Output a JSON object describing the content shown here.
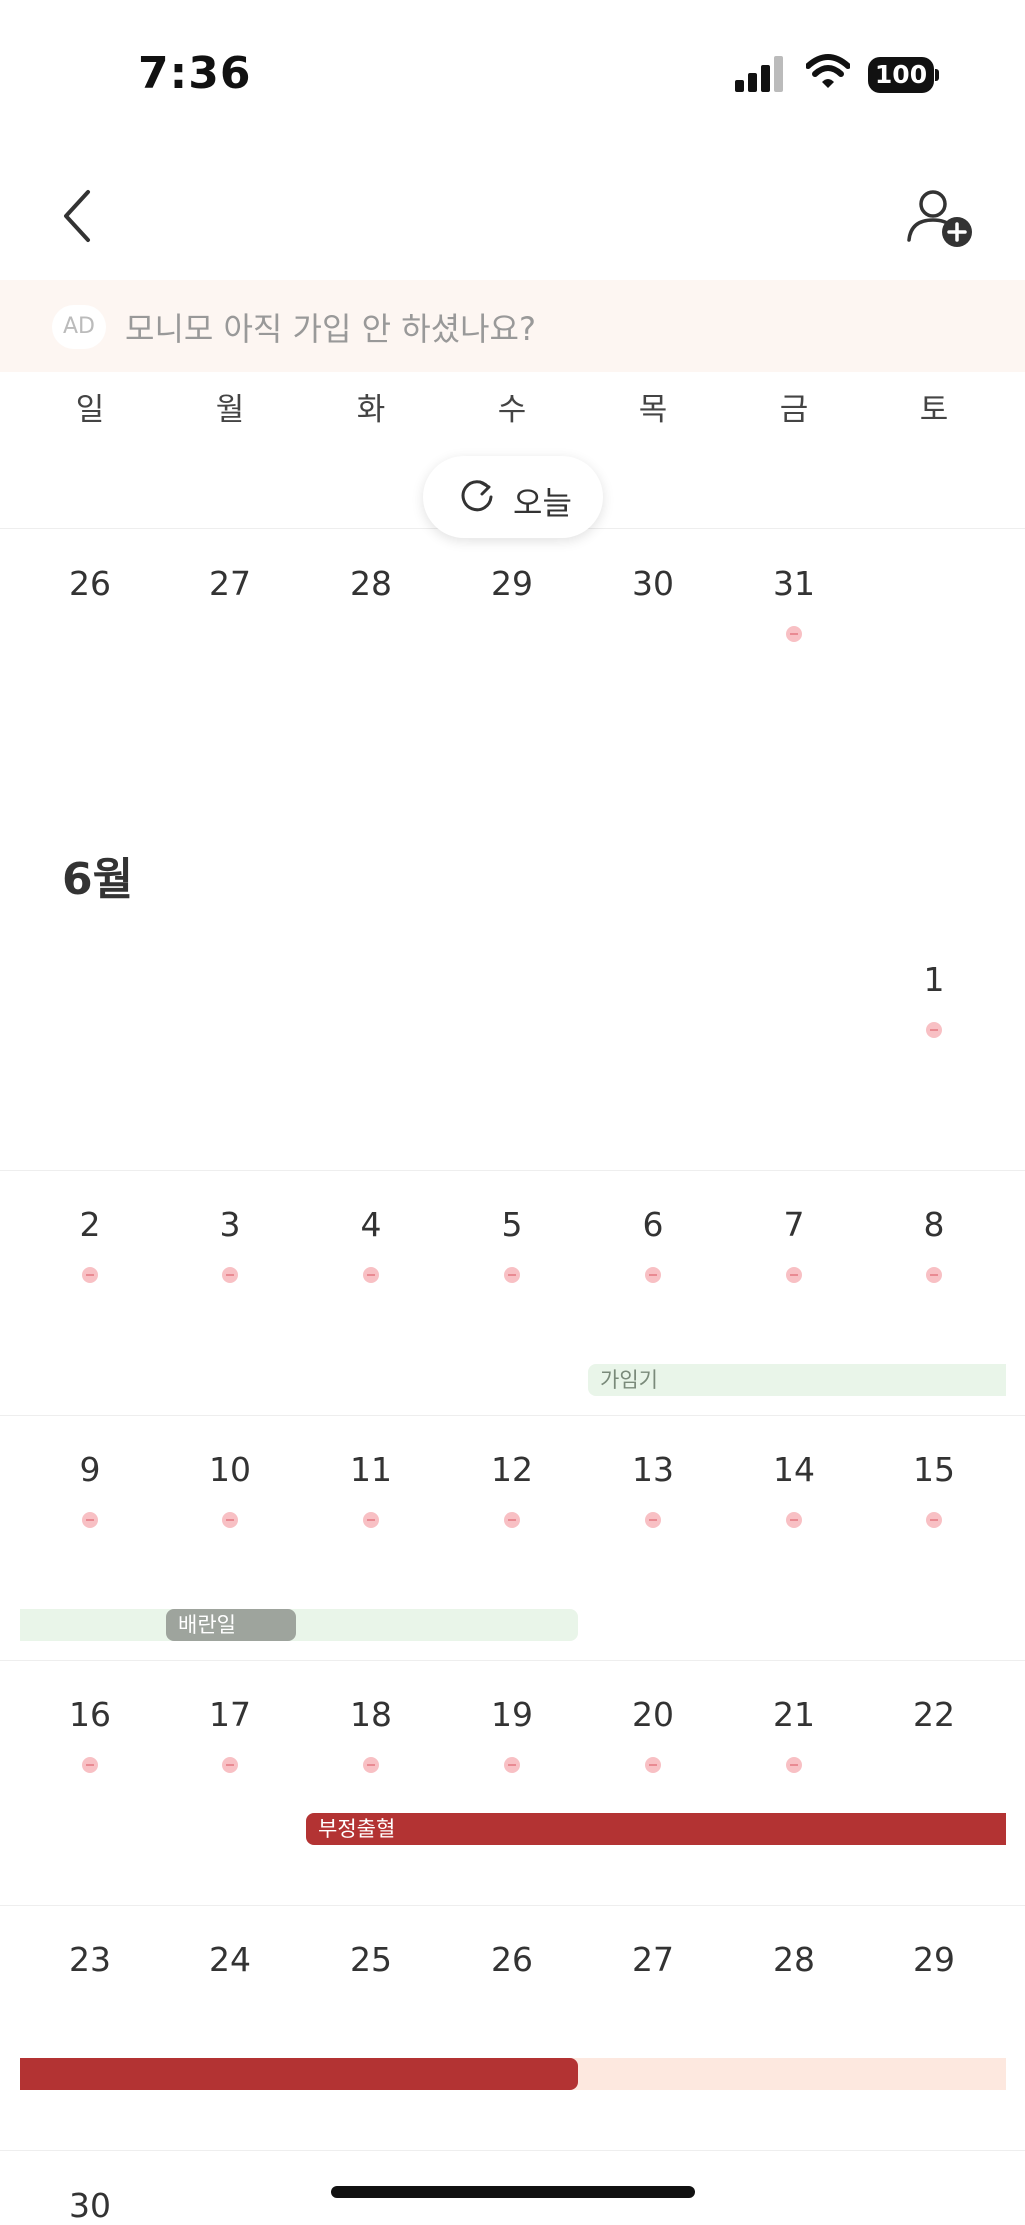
{
  "status_bar": {
    "time": "7:36",
    "battery": "100"
  },
  "ad": {
    "badge": "AD",
    "text": "모니모 아직 가입 안 하셨나요?"
  },
  "weekdays": [
    "일",
    "월",
    "화",
    "수",
    "목",
    "금",
    "토"
  ],
  "today_button": {
    "label": "오늘"
  },
  "month_label": "6월",
  "prev_month_days": [
    "26",
    "27",
    "28",
    "29",
    "30",
    "31"
  ],
  "weeks": {
    "w1": [
      "1"
    ],
    "w2": [
      "2",
      "3",
      "4",
      "5",
      "6",
      "7",
      "8"
    ],
    "w3": [
      "9",
      "10",
      "11",
      "12",
      "13",
      "14",
      "15"
    ],
    "w4": [
      "16",
      "17",
      "18",
      "19",
      "20",
      "21",
      "22"
    ],
    "w5": [
      "23",
      "24",
      "25",
      "26",
      "27",
      "28",
      "29"
    ],
    "w6": [
      "30"
    ]
  },
  "events": {
    "fertile": "가임기",
    "ovulation": "배란일",
    "spotting": "부정출혈"
  },
  "colors": {
    "fertile_bg": "#e9f5e9",
    "ovulation": "#9ea49d",
    "spotting": "#b33333",
    "period_forecast": "#fde8df",
    "dot": "#f8c0c4"
  }
}
